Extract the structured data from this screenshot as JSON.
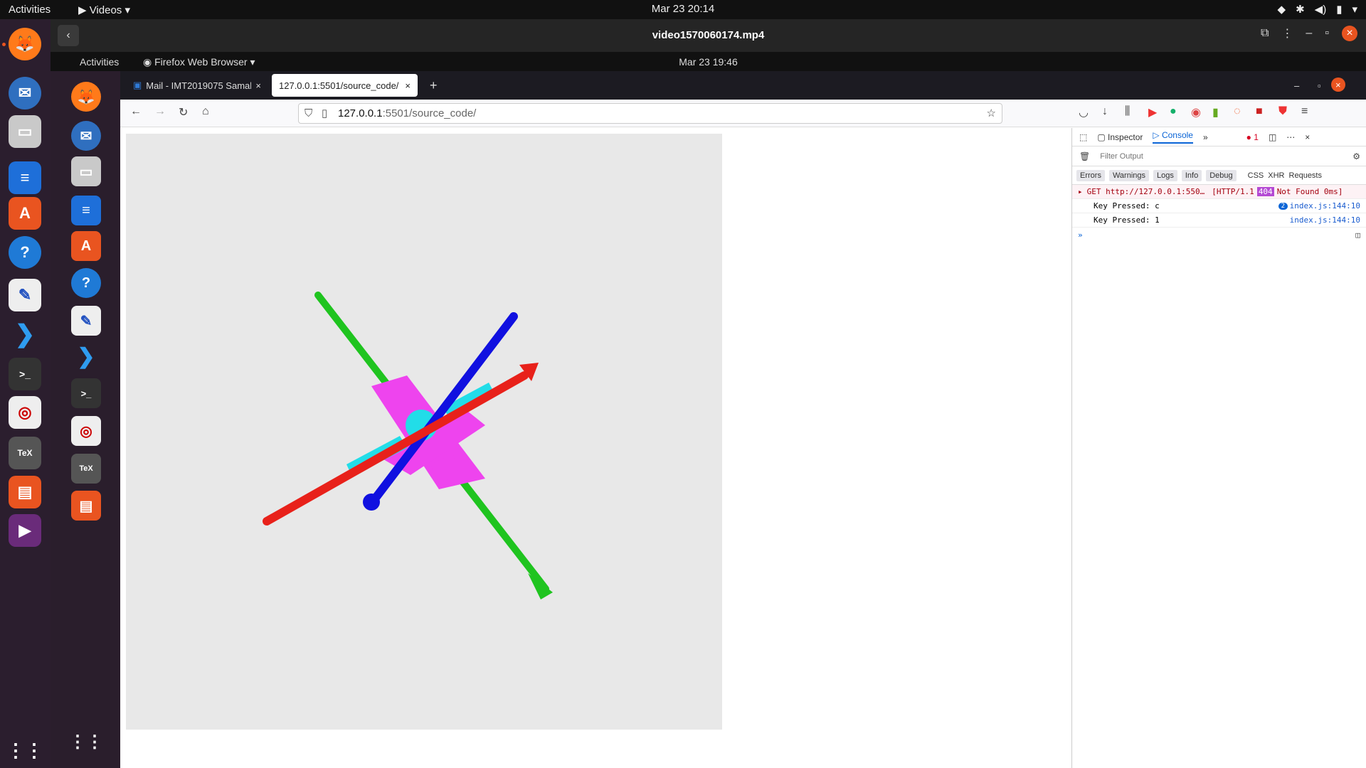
{
  "os_topbar": {
    "activities": "Activities",
    "app_menu": "Videos",
    "clock": "Mar 23  20:14"
  },
  "player": {
    "title": "video1570060174.mp4"
  },
  "inner": {
    "topbar": {
      "activities": "Activities",
      "app_menu": "Firefox Web Browser",
      "clock": "Mar 23  19:46"
    },
    "tabs": [
      {
        "label": "Mail - IMT2019075 Samak"
      },
      {
        "label": "127.0.0.1:5501/source_code/"
      }
    ],
    "url_host": "127.0.0.1",
    "url_rest": ":5501/source_code/",
    "devtools": {
      "inspector": "Inspector",
      "console": "Console",
      "error_count": "1",
      "filter_placeholder": "Filter Output",
      "levels": [
        "Errors",
        "Warnings",
        "Logs",
        "Info",
        "Debug"
      ],
      "extra_filters": [
        "CSS",
        "XHR",
        "Requests"
      ],
      "logs": [
        {
          "text": "GET http://127.0.0.1:550…",
          "status": "[HTTP/1.1",
          "code": "404",
          "status_text": "Not Found 0ms]",
          "source": ""
        },
        {
          "text": "Key Pressed: c",
          "badge": "2",
          "source": "index.js:144:10"
        },
        {
          "text": "Key Pressed: 1",
          "source": "index.js:144:10"
        }
      ]
    }
  },
  "colors": {
    "x_axis": "#e8211a",
    "y_axis": "#1fc41f",
    "z_axis": "#1010e0",
    "model_magenta": "#ee44ee",
    "model_cyan": "#22dde8",
    "canvas_bg": "#e8e8e8"
  }
}
